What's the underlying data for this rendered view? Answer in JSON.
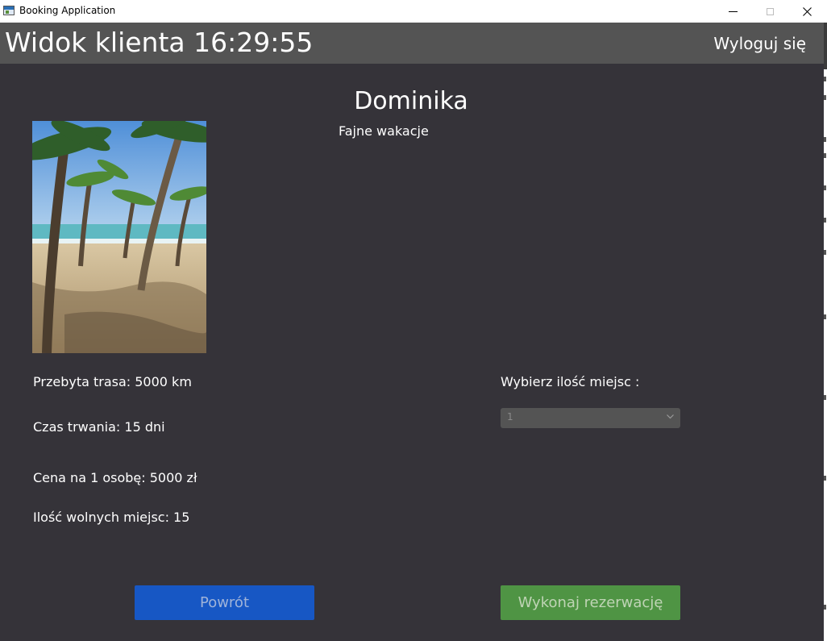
{
  "window": {
    "title": "Booking Application"
  },
  "header": {
    "title": "Widok klienta 16:29:55",
    "logout_label": "Wyloguj się"
  },
  "offer": {
    "name": "Dominika",
    "description": "Fajne wakacje",
    "details": {
      "distance": "Przebyta trasa: 5000 km",
      "duration": "Czas trwania: 15 dni",
      "price": "Cena na 1 osobę: 5000 zł",
      "free_seats": "Ilość wolnych miejsc: 15"
    }
  },
  "seats": {
    "label": "Wybierz ilość miejsc :",
    "selected": "1"
  },
  "buttons": {
    "back_label": "Powrót",
    "book_label": "Wykonaj rezerwację"
  },
  "colors": {
    "background": "#353339",
    "header": "#545454",
    "back_button": "#1757c4",
    "book_button": "#4f9444"
  },
  "icons": {
    "app": "app-icon",
    "minimize": "minimize-icon",
    "maximize": "maximize-icon",
    "close": "close-icon",
    "dropdown": "chevron-down-icon"
  }
}
